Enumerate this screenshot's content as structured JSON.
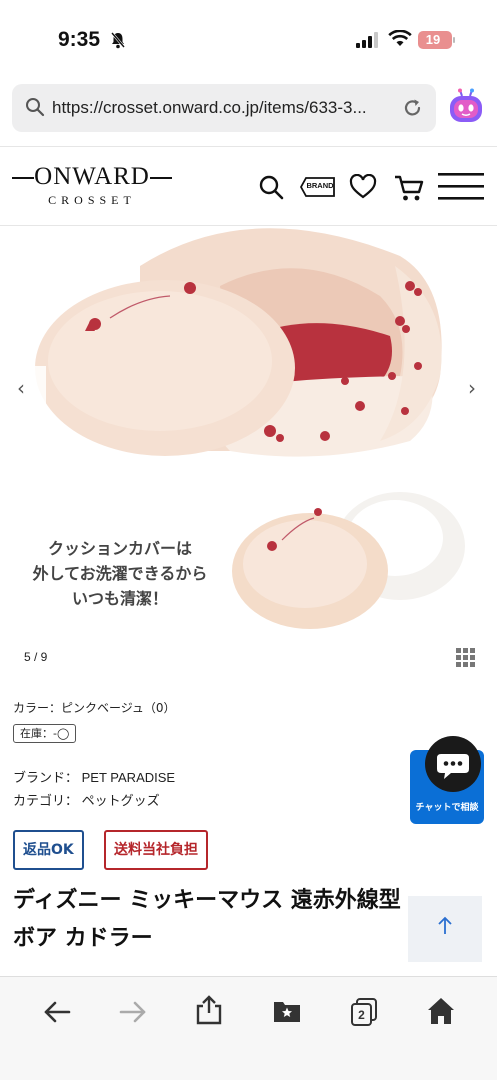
{
  "status_bar": {
    "time": "9:35",
    "battery": "19",
    "icons": [
      "bell-slash-icon",
      "signal-icon",
      "wifi-icon",
      "battery-icon"
    ]
  },
  "browser": {
    "url": "https://crosset.onward.co.jp/items/633-3...",
    "icons": [
      "search-icon",
      "reload-icon",
      "mascot-icon"
    ]
  },
  "site": {
    "logo_word": "ONWARD",
    "logo_sub": "CROSSET",
    "brand_label": "BRAND",
    "header_icons": [
      "search-icon",
      "brand-tag-icon",
      "heart-icon",
      "cart-icon",
      "menu-icon"
    ]
  },
  "gallery": {
    "caption_lines": [
      "クッションカバーは",
      "外してお洗濯できるから",
      "いつも清潔！"
    ],
    "pager": "5 / 9"
  },
  "product": {
    "color_line": "カラー：ピンクベージュ（0）",
    "stock": "在庫：-◯",
    "brand_key": "ブランド：",
    "brand_value": "PET PARADISE",
    "category_key": "カテゴリ：",
    "category_value": "ペットグッズ",
    "badges": [
      "返品OK",
      "送料当社負担"
    ],
    "title": "ディズニー ミッキーマウス 遠赤外線型 ボア カドラー"
  },
  "chat": {
    "label": "チャットで相談"
  },
  "toolbar": {
    "tabs_count": "2",
    "icons": [
      "back-icon",
      "forward-icon",
      "share-icon",
      "bookmarks-icon",
      "tabs-icon",
      "home-icon"
    ]
  },
  "colors": {
    "badge_blue": "#1f4f8f",
    "badge_red": "#b5262b",
    "chat_blue": "#0b6fd6",
    "battery_red": "#e98f8f"
  }
}
